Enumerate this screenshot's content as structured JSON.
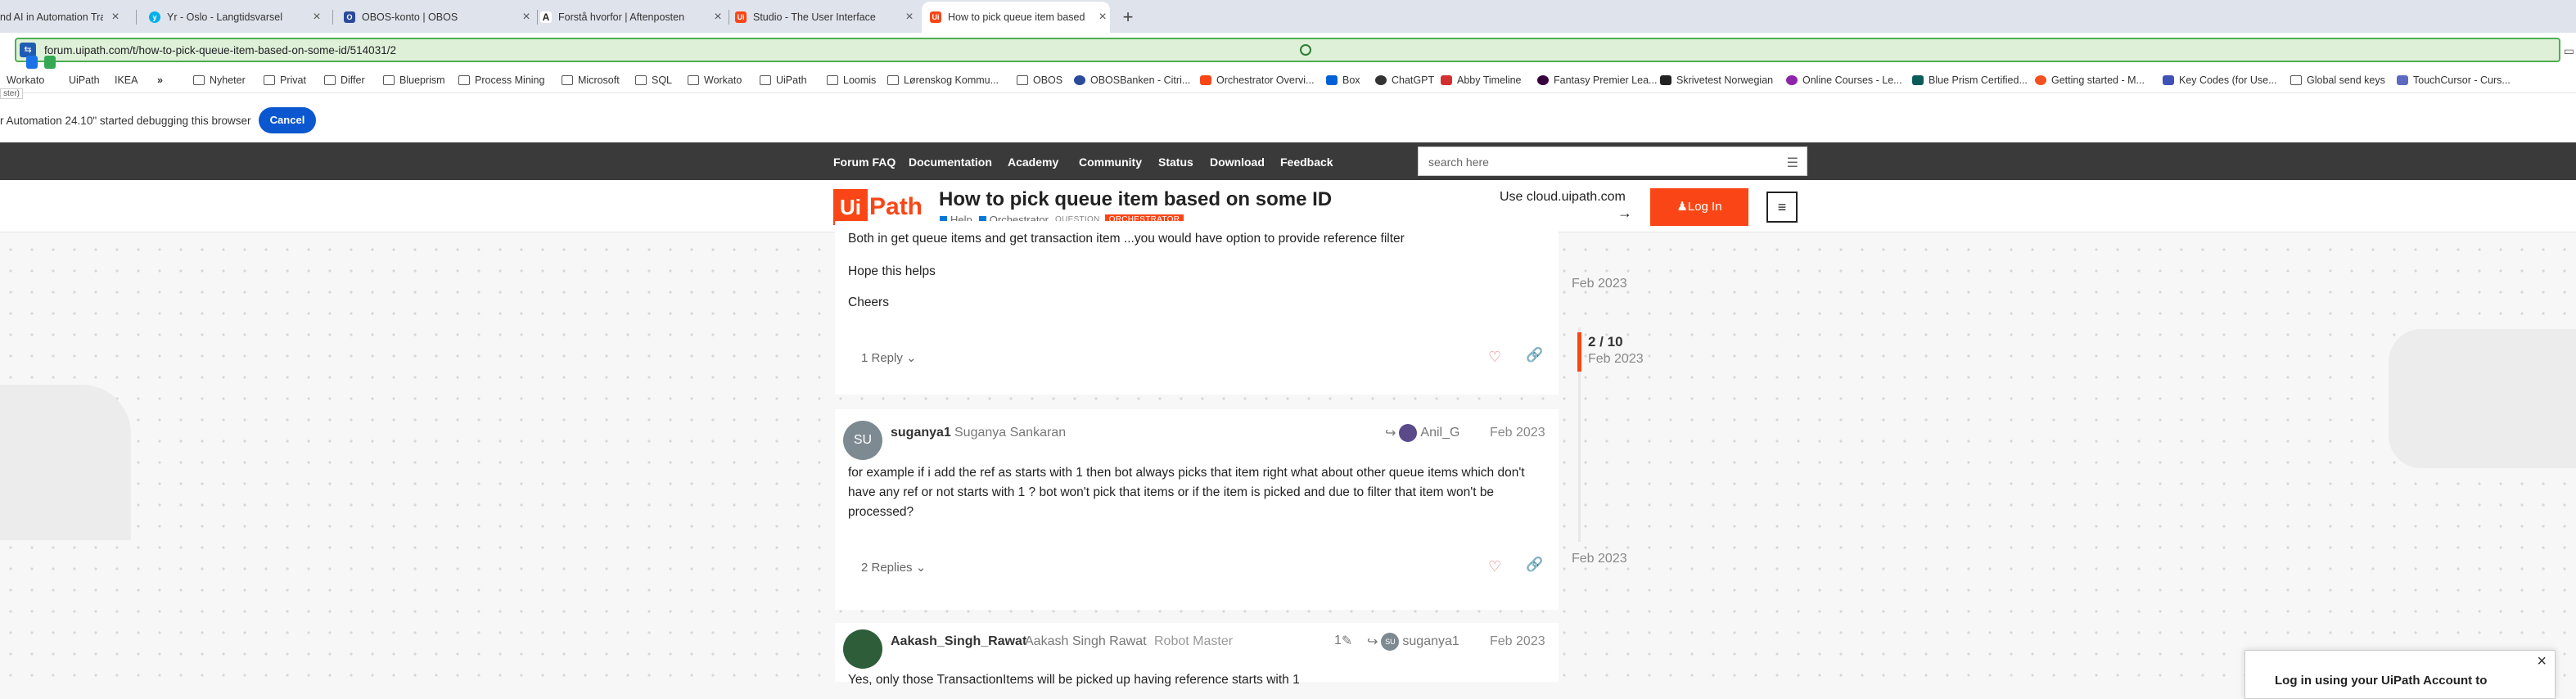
{
  "browser": {
    "tabs": [
      {
        "label": "nd AI in Automation Trai",
        "color": "#e8e8e8"
      },
      {
        "label": "Yr - Oslo - Langtidsvarsel",
        "color": "#00b0ea"
      },
      {
        "label": "OBOS-konto | OBOS",
        "color": "#2b4a9b"
      },
      {
        "label": "Forstå hvorfor | Aftenposten",
        "color": "#222222"
      },
      {
        "label": "Studio - The User Interface",
        "color": "#fa4616"
      },
      {
        "label": "How to pick queue item based",
        "color": "#fa4616"
      }
    ],
    "active_tab_index": 5,
    "new_tab_symbol": "+",
    "url": "forum.uipath.com/t/how-to-pick-queue-item-based-on-some-id/514031/2",
    "bookmarks": [
      {
        "label": "Workato",
        "icon": "folder-icon"
      },
      {
        "label": "UiPath",
        "icon": "folder-icon"
      },
      {
        "label": "IKEA",
        "icon": "folder-icon"
      },
      {
        "label": "»",
        "icon": "none"
      },
      {
        "label": "Nyheter",
        "icon": "folder-icon"
      },
      {
        "label": "Privat",
        "icon": "folder-icon"
      },
      {
        "label": "Differ",
        "icon": "folder-icon"
      },
      {
        "label": "Blueprism",
        "icon": "folder-icon"
      },
      {
        "label": "Process Mining",
        "icon": "folder-icon"
      },
      {
        "label": "Microsoft",
        "icon": "folder-icon"
      },
      {
        "label": "SQL",
        "icon": "folder-icon"
      },
      {
        "label": "Workato",
        "icon": "folder-icon"
      },
      {
        "label": "UiPath",
        "icon": "folder-icon"
      },
      {
        "label": "Loomis",
        "icon": "folder-icon"
      },
      {
        "label": "Lørenskog Kommu...",
        "icon": "folder-icon"
      },
      {
        "label": "OBOS",
        "icon": "folder-icon"
      },
      {
        "label": "OBOSBanken - Citri...",
        "icon": "site-icon"
      },
      {
        "label": "Orchestrator Overvi...",
        "icon": "site-icon"
      },
      {
        "label": "Box",
        "icon": "site-icon"
      },
      {
        "label": "ChatGPT",
        "icon": "site-icon"
      },
      {
        "label": "Abby Timeline",
        "icon": "site-icon"
      },
      {
        "label": "Fantasy Premier Lea...",
        "icon": "site-icon"
      },
      {
        "label": "Skrivetest Norwegian",
        "icon": "site-icon"
      },
      {
        "label": "Online Courses - Le...",
        "icon": "site-icon"
      },
      {
        "label": "Blue Prism Certified...",
        "icon": "site-icon"
      },
      {
        "label": "Getting started - M...",
        "icon": "site-icon"
      },
      {
        "label": "Key Codes (for Use...",
        "icon": "site-icon"
      },
      {
        "label": "Global send keys",
        "icon": "folder-icon"
      },
      {
        "label": "TouchCursor - Curs...",
        "icon": "site-icon"
      }
    ],
    "debug_message": "r Automation 24.10\" started debugging this browser",
    "debug_cancel": "Cancel",
    "tiny_label": "ster)"
  },
  "forum": {
    "nav": [
      "Forum FAQ",
      "Documentation",
      "Academy",
      "Community",
      "Status",
      "Download",
      "Feedback"
    ],
    "search_placeholder": "search here",
    "logo_ui": "Ui",
    "logo_path": "Path",
    "topic_title": "How to pick queue item based on some ID",
    "categories": [
      "Help",
      "Orchestrator"
    ],
    "tags": [
      "QUESTION",
      "ORCHESTRATOR"
    ],
    "use_cloud": "Use cloud.uipath.com",
    "use_cloud_arrow": "→",
    "login": "Log In"
  },
  "posts": [
    {
      "lines": [
        "Both in get queue items and get transaction item ...you would have option to provide reference filter",
        "Hope this helps",
        "Cheers"
      ],
      "replies": "1 Reply"
    },
    {
      "avatar_initials": "SU",
      "avatar_color": "#7d8a92",
      "username": "suganya1",
      "fullname": "Suganya Sankaran",
      "reply_to": "Anil_G",
      "date": "Feb 2023",
      "text": "for example if i add the ref as starts with 1 then bot always picks that item right what about other queue items which don't have any ref or not starts with 1 ? bot won't pick that items or if the item is picked and due to filter that item won't be processed?",
      "replies": "2 Replies"
    },
    {
      "username": "Aakash_Singh_Rawat",
      "fullname": "Aakash Singh Rawat",
      "role": "Robot Master",
      "edits": "1",
      "reply_to": "suganya1",
      "date": "Feb 2023",
      "partial_text": "Yes, only those TransactionItems will be picked up having reference starts with 1"
    }
  ],
  "timeline": {
    "top_date": "Feb 2023",
    "position": "2 / 10",
    "position_date": "Feb 2023",
    "bottom_date": "Feb 2023"
  },
  "login_modal": {
    "text": "Log in using your UiPath Account to",
    "close": "×"
  },
  "colors": {
    "accent": "#fa4616",
    "nav_bg": "#3a3a3a",
    "omnibox_bg": "#dff0d8",
    "omnibox_border": "#4caf50",
    "cancel_btn": "#0b57d0"
  }
}
